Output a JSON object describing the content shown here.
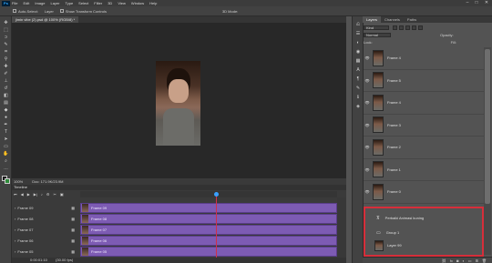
{
  "menubar": {
    "logo": "Ps",
    "items": [
      "File",
      "Edit",
      "Image",
      "Layer",
      "Type",
      "Select",
      "Filter",
      "3D",
      "View",
      "Window",
      "Help"
    ],
    "window_controls": [
      "–",
      "□",
      "✕"
    ]
  },
  "options": {
    "auto_select_label": "Auto-Select:",
    "auto_select_value": "Layer",
    "transform_label": "Show Transform Controls",
    "mode_3d": "3D Mode:"
  },
  "document": {
    "tab_title": "jimin vibe (2).psd @ 100% (RGB/8) *",
    "status_zoom": "100%",
    "status_doc": "Doc: 171.9K/23.9M"
  },
  "timeline": {
    "title": "Timeline",
    "time_readout": "0:00:01:10",
    "fps": "(30.00 fps)",
    "tracks": [
      {
        "label": "Frame 09",
        "clip": "Frame 09"
      },
      {
        "label": "Frame 08",
        "clip": "Frame 08"
      },
      {
        "label": "Frame 07",
        "clip": "Frame 07"
      },
      {
        "label": "Frame 06",
        "clip": "Frame 06"
      },
      {
        "label": "Frame 05",
        "clip": "Frame 05"
      }
    ]
  },
  "layers_panel": {
    "tabs": [
      "Layers",
      "Channels",
      "Paths"
    ],
    "filter_kind": "Kind",
    "blend_mode": "Normal",
    "opacity_label": "Opacity:",
    "lock_label": "Lock:",
    "fill_label": "Fill:",
    "layers": [
      {
        "name": "Frame 4"
      },
      {
        "name": "Frame 5"
      },
      {
        "name": "Frame 4"
      },
      {
        "name": "Frame 3"
      },
      {
        "name": "Frame 2"
      },
      {
        "name": "Frame 1"
      },
      {
        "name": "Frame 0"
      }
    ],
    "groups": [
      {
        "name": "Perbaiki Animasi kuning"
      },
      {
        "name": "Group 1"
      },
      {
        "name": "Layer 99"
      }
    ]
  },
  "colors": {
    "track_purple": "#7d5bb3",
    "playhead": "#d0304a",
    "selection_outline": "#d62e3a"
  }
}
